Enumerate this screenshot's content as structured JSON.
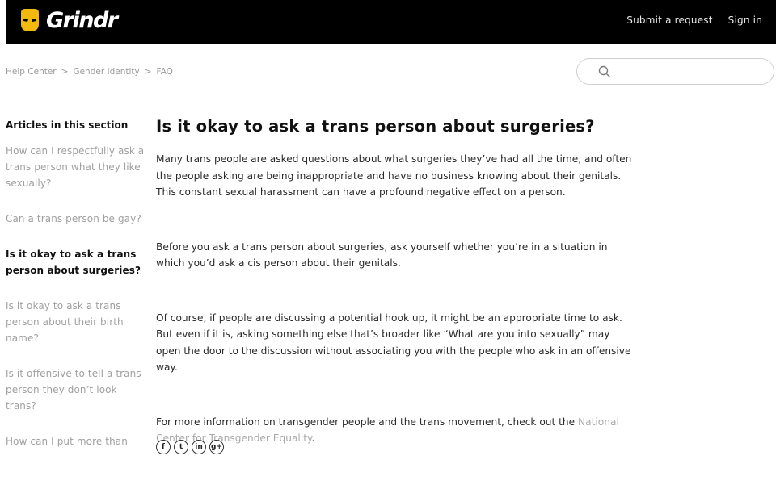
{
  "header": {
    "brand": "Grindr",
    "submit_request": "Submit a request",
    "sign_in": "Sign in"
  },
  "breadcrumb": [
    {
      "label": "Help Center"
    },
    {
      "label": "Gender Identity"
    },
    {
      "label": "FAQ"
    }
  ],
  "breadcrumb_separator": ">",
  "search": {
    "placeholder": ""
  },
  "sidebar": {
    "title": "Articles in this section",
    "items": [
      {
        "label": "How can I respectfully ask a trans person what they like sexually?"
      },
      {
        "label": "Can a trans person be gay?"
      },
      {
        "label": "Is it okay to ask a trans person about surgeries?",
        "active": true
      },
      {
        "label": "Is it okay to ask a trans person about their birth name?"
      },
      {
        "label": "Is it offensive to tell a trans person they don’t look trans?"
      },
      {
        "label": "How can I put more than"
      }
    ]
  },
  "article": {
    "title": "Is it okay to ask a trans person about surgeries?",
    "p1": "Many trans people are asked questions about what surgeries they’ve had all the time, and often the people asking are being inappropriate and have no business knowing about their genitals. This constant sexual harassment can have a profound negative effect on a person.",
    "p2": "Before you ask a trans person about surgeries, ask yourself whether you’re in a situation in which you’d ask a cis person about their genitals.",
    "p3": "Of course, if people are discussing a potential hook up, it might be an appropriate time to ask. But even if it is, asking something else that’s broader like “What are you into sexually” may open the door to the discussion without associating you with the people who ask in an offensive way.",
    "p4_prefix": "For more information on transgender people and the trans movement, check out the ",
    "p4_link": "National Center for Transgender Equality",
    "p4_suffix": "."
  },
  "share": [
    {
      "icon": "facebook-icon",
      "glyph": "f"
    },
    {
      "icon": "twitter-icon",
      "glyph": "t"
    },
    {
      "icon": "linkedin-icon",
      "glyph": "in"
    },
    {
      "icon": "google-plus-icon",
      "glyph": "g+"
    }
  ],
  "colors": {
    "header_bg": "#000000",
    "logo_yellow": "#f2b90f",
    "muted": "#9a9a9a"
  }
}
